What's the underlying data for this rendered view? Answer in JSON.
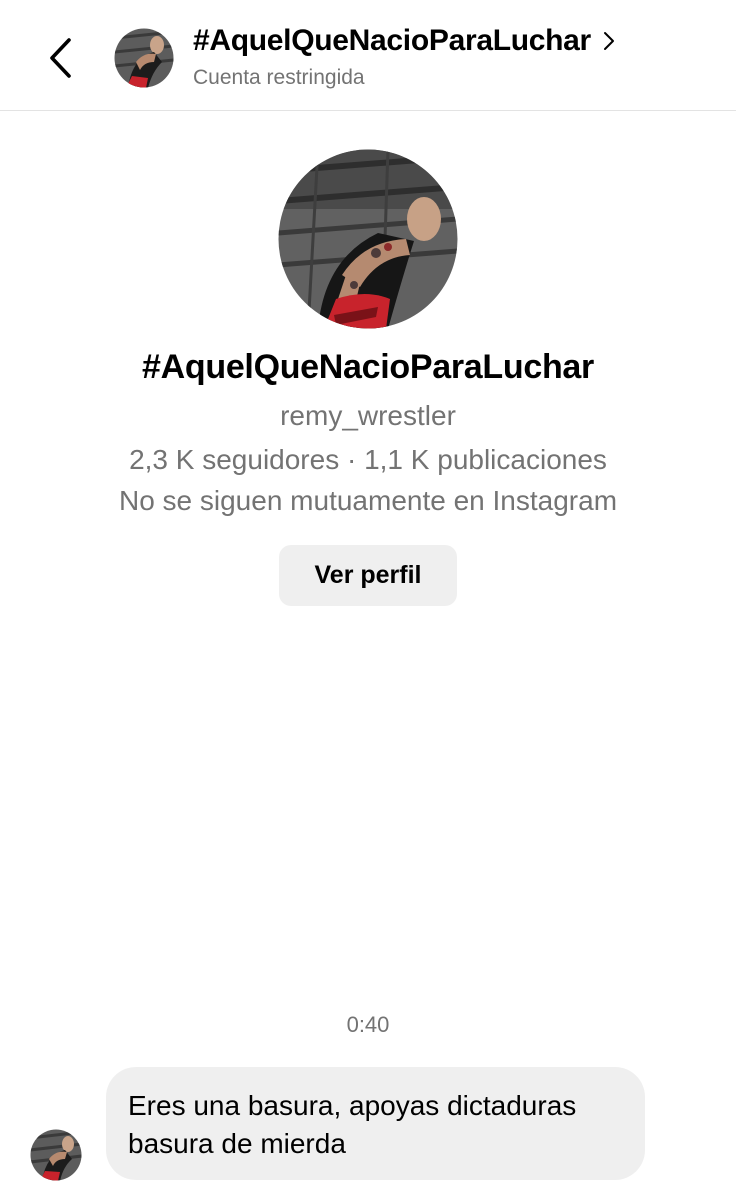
{
  "header": {
    "title": "#AquelQueNacioParaLuchar",
    "subtitle": "Cuenta restringida",
    "back_icon": "chevron-left-icon",
    "title_chevron_icon": "chevron-right-icon"
  },
  "profile": {
    "display_name": "#AquelQueNacioParaLuchar",
    "username": "remy_wrestler",
    "stats": "2,3 K seguidores · 1,1 K publicaciones",
    "mutual_status": "No se siguen mutuamente en Instagram",
    "view_profile_label": "Ver perfil"
  },
  "conversation": {
    "timestamp": "0:40",
    "messages": [
      {
        "lines": [
          "Eres una basura, apoyas dictaduras",
          "basura de mierda"
        ]
      }
    ]
  },
  "colors": {
    "text_primary": "#000000",
    "text_secondary": "#737373",
    "bubble_bg": "#efefef",
    "button_bg": "#efefef",
    "divider": "#e3e3e3"
  }
}
